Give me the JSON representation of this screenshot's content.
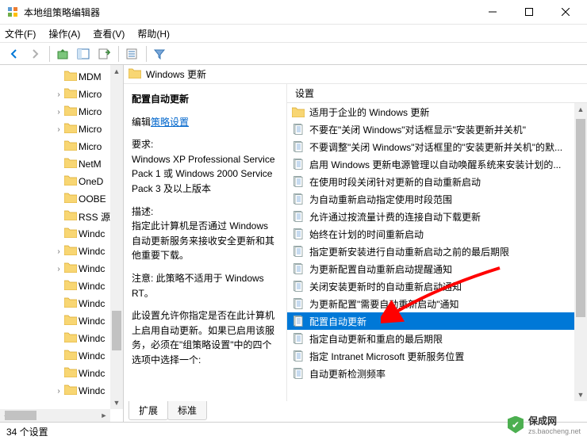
{
  "window": {
    "title": "本地组策略编辑器"
  },
  "menu": {
    "items": [
      "文件(F)",
      "操作(A)",
      "查看(V)",
      "帮助(H)"
    ]
  },
  "tree": {
    "items": [
      {
        "label": "MDM",
        "caret": ""
      },
      {
        "label": "Micro",
        "caret": "›"
      },
      {
        "label": "Micro",
        "caret": "›"
      },
      {
        "label": "Micro",
        "caret": "›"
      },
      {
        "label": "Micro",
        "caret": ""
      },
      {
        "label": "NetM",
        "caret": ""
      },
      {
        "label": "OneD",
        "caret": ""
      },
      {
        "label": "OOBE",
        "caret": ""
      },
      {
        "label": "RSS 源",
        "caret": ""
      },
      {
        "label": "Windc",
        "caret": ""
      },
      {
        "label": "Windc",
        "caret": "›"
      },
      {
        "label": "Windc",
        "caret": "›"
      },
      {
        "label": "Windc",
        "caret": ""
      },
      {
        "label": "Windc",
        "caret": ""
      },
      {
        "label": "Windc",
        "caret": ""
      },
      {
        "label": "Windc",
        "caret": ""
      },
      {
        "label": "Windc",
        "caret": ""
      },
      {
        "label": "Windc",
        "caret": ""
      },
      {
        "label": "Windc",
        "caret": "›"
      }
    ]
  },
  "detail": {
    "header": "Windows 更新",
    "desc": {
      "title": "配置自动更新",
      "edit_prefix": "编辑",
      "edit_link": "策略设置",
      "req_label": "要求:",
      "req_text": "Windows XP Professional Service Pack 1 或 Windows 2000 Service Pack 3 及以上版本",
      "desc_label": "描述:",
      "desc_text": "指定此计算机是否通过 Windows 自动更新服务来接收安全更新和其他重要下载。",
      "note": "注意: 此策略不适用于 Windows RT。",
      "body2": "此设置允许你指定是否在此计算机上启用自动更新。如果已启用该服务，必须在\"组策略设置\"中的四个选项中选择一个:"
    },
    "list": {
      "column": "设置",
      "items": [
        {
          "type": "folder",
          "label": "适用于企业的 Windows 更新"
        },
        {
          "type": "policy",
          "label": "不要在\"关闭 Windows\"对话框显示\"安装更新并关机\""
        },
        {
          "type": "policy",
          "label": "不要调整\"关闭 Windows\"对话框里的\"安装更新并关机\"的默..."
        },
        {
          "type": "policy",
          "label": "启用 Windows 更新电源管理以自动唤醒系统来安装计划的..."
        },
        {
          "type": "policy",
          "label": "在使用时段关闭针对更新的自动重新启动"
        },
        {
          "type": "policy",
          "label": "为自动重新启动指定使用时段范围"
        },
        {
          "type": "policy",
          "label": "允许通过按流量计费的连接自动下载更新"
        },
        {
          "type": "policy",
          "label": "始终在计划的时间重新启动"
        },
        {
          "type": "policy",
          "label": "指定更新安装进行自动重新启动之前的最后期限"
        },
        {
          "type": "policy",
          "label": "为更新配置自动重新启动提醒通知"
        },
        {
          "type": "policy",
          "label": "关闭安装更新时的自动重新启动通知"
        },
        {
          "type": "policy",
          "label": "为更新配置\"需要自动重新启动\"通知"
        },
        {
          "type": "policy",
          "label": "配置自动更新",
          "selected": true
        },
        {
          "type": "policy",
          "label": "指定自动更新和重启的最后期限"
        },
        {
          "type": "policy",
          "label": "指定 Intranet Microsoft 更新服务位置"
        },
        {
          "type": "policy",
          "label": "自动更新检测频率"
        }
      ]
    },
    "tabs": {
      "extended": "扩展",
      "standard": "标准"
    }
  },
  "status": {
    "text": "34 个设置"
  },
  "watermark": {
    "name": "保成网",
    "sub": "zs.baocheng.net"
  }
}
